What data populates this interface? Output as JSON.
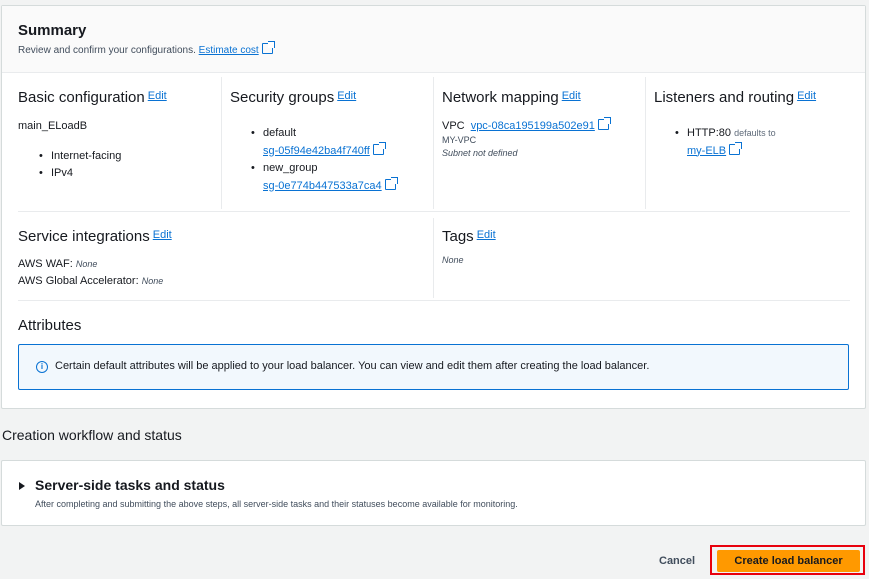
{
  "summary": {
    "title": "Summary",
    "description": "Review and confirm your configurations.",
    "estimate_cost": "Estimate cost"
  },
  "edit_label": "Edit",
  "basic": {
    "title": "Basic configuration",
    "name": "main_ELoadB",
    "items": [
      "Internet-facing",
      "IPv4"
    ]
  },
  "security": {
    "title": "Security groups",
    "groups": [
      {
        "name": "default",
        "id": "sg-05f94e42ba4f740ff"
      },
      {
        "name": "new_group",
        "id": "sg-0e774b447533a7ca4"
      }
    ]
  },
  "network": {
    "title": "Network mapping",
    "vpc_label": "VPC",
    "vpc_id": "vpc-08ca195199a502e91",
    "vpc_name": "MY-VPC",
    "subnet": "Subnet not defined"
  },
  "listeners": {
    "title": "Listeners and routing",
    "protocol": "HTTP:80",
    "defaults_to": "defaults to",
    "target": "my-ELB"
  },
  "service": {
    "title": "Service integrations",
    "waf_label": "AWS WAF:",
    "waf_value": "None",
    "ga_label": "AWS Global Accelerator:",
    "ga_value": "None"
  },
  "tags": {
    "title": "Tags",
    "value": "None"
  },
  "attributes": {
    "title": "Attributes",
    "info": "Certain default attributes will be applied to your load balancer. You can view and edit them after creating the load balancer."
  },
  "workflow": {
    "title": "Creation workflow and status",
    "server_title": "Server-side tasks and status",
    "server_desc": "After completing and submitting the above steps, all server-side tasks and their statuses become available for monitoring."
  },
  "footer": {
    "cancel": "Cancel",
    "create": "Create load balancer"
  },
  "colors": {
    "link": "#0972d3",
    "primary_button": "#ff9900",
    "highlight_outline": "#e8000d"
  }
}
